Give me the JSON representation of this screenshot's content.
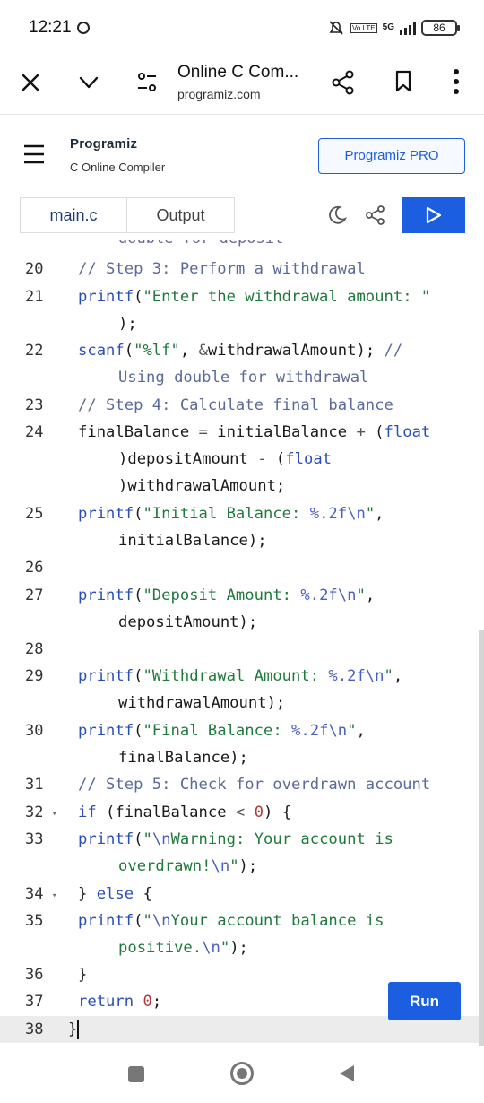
{
  "status_bar": {
    "time": "12:21",
    "battery": "86",
    "network": "5G",
    "volte": "Vo LTE"
  },
  "browser": {
    "title": "Online C Com...",
    "url": "programiz.com",
    "icons": [
      "close-icon",
      "chevron-down-icon",
      "tune-icon",
      "share-icon",
      "bookmark-icon",
      "more-vert-icon"
    ]
  },
  "header": {
    "logo": "Programiz",
    "subtitle": "C Online Compiler",
    "pro_button": "Programiz PRO",
    "icons": [
      "menu-icon"
    ]
  },
  "tabs": {
    "main": "main.c",
    "output": "Output",
    "icons": [
      "moon-icon",
      "share-icon",
      "play-icon"
    ]
  },
  "editor": {
    "clipped_line": "double for deposit",
    "lines": [
      {
        "no": "20",
        "text": "// Step 3: Perform a withdrawal"
      },
      {
        "no": "21",
        "text": "printf(\"Enter the withdrawal amount: \");"
      },
      {
        "no": "22",
        "text": "scanf(\"%lf\", &withdrawalAmount); // Using double for withdrawal"
      },
      {
        "no": "23",
        "text": "// Step 4: Calculate final balance"
      },
      {
        "no": "24",
        "text": "finalBalance = initialBalance + (float)depositAmount - (float)withdrawalAmount;"
      },
      {
        "no": "25",
        "text": "printf(\"Initial Balance: %.2f\\n\", initialBalance);"
      },
      {
        "no": "26",
        "text": ""
      },
      {
        "no": "27",
        "text": "printf(\"Deposit Amount: %.2f\\n\", depositAmount);"
      },
      {
        "no": "28",
        "text": ""
      },
      {
        "no": "29",
        "text": "printf(\"Withdrawal Amount: %.2f\\n\", withdrawalAmount);"
      },
      {
        "no": "30",
        "text": "printf(\"Final Balance: %.2f\\n\", finalBalance);"
      },
      {
        "no": "31",
        "text": "// Step 5: Check for overdrawn account"
      },
      {
        "no": "32",
        "text": "if (finalBalance < 0) {"
      },
      {
        "no": "33",
        "text": "printf(\"\\nWarning: Your account is overdrawn!\\n\");"
      },
      {
        "no": "34",
        "text": "} else {"
      },
      {
        "no": "35",
        "text": "printf(\"\\nYour account balance is positive.\\n\");"
      },
      {
        "no": "36",
        "text": "}"
      },
      {
        "no": "37",
        "text": "return 0;"
      },
      {
        "no": "38",
        "text": "}"
      }
    ],
    "run_button": "Run"
  },
  "nav": {
    "icons": [
      "recents-icon",
      "home-icon",
      "back-icon"
    ]
  },
  "colors": {
    "accent": "#1b5fe0"
  }
}
